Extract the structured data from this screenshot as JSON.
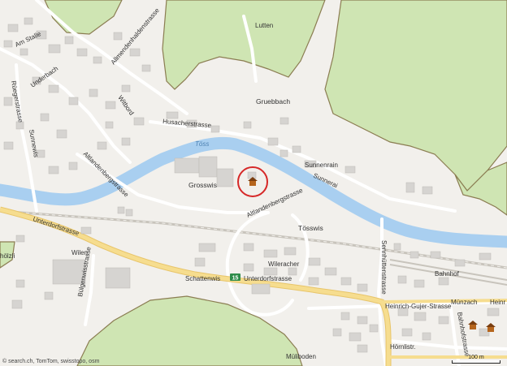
{
  "map": {
    "places": {
      "am_stalle": "Am Stalle",
      "underbach": "Underbach",
      "ruegerstrasse": "Rüegerstrasse",
      "sunnewis": "Sunnewis",
      "allmendenhaldenstrasse": "Allmendenhaldenstrasse",
      "witbord": "Witbord",
      "lutten": "Lutten",
      "gruebbach": "Gruebbach",
      "husacherstrasse": "Husacherstrasse",
      "toess": "Töss",
      "sunnenrain": "Sunnenrain",
      "sunnerai": "Sunnerai",
      "grosswis": "Grosswis",
      "altlandenbergstrasse_w": "Altlandenbergstrasse",
      "altlandenbergstrasse_e": "Altlandenbergstrasse",
      "toesswis": "Tösswis",
      "unterdorfstrasse_w": "Unterdorfstrasse",
      "unterdorfstrasse_e": "Unterdorfstrasse",
      "wilen": "Wilen",
      "hoelzli": "hölzli",
      "buehlgenwisstrasse": "Bülgenwisstrasse",
      "schattenwis": "Schattenwis",
      "wileracher": "Wileracher",
      "sennhuettenstrasse": "Sennhüttenstrasse",
      "bahnhof": "Bahnhof",
      "muenzach": "Münzach",
      "heinrich_gujer_strasse": "Heinrich-Gujer-Strasse",
      "heinr": "Heinr",
      "bahnhofstrasse": "Bahnhofstrasse",
      "hoernlistr": "Hörnlistr.",
      "mueliboden": "Müliboden"
    },
    "route_badge": "15",
    "scale_label": "100 m",
    "attribution": "© search.ch, TomTom, swisstopo, osm",
    "colors": {
      "background": "#f2f0ec",
      "forest": "#cfe5b3",
      "forest_border": "#8b7d52",
      "river": "#a9cff0",
      "main_road": "#f6dd8f",
      "building": "#d6d4d1",
      "marker": "#d62828"
    }
  }
}
